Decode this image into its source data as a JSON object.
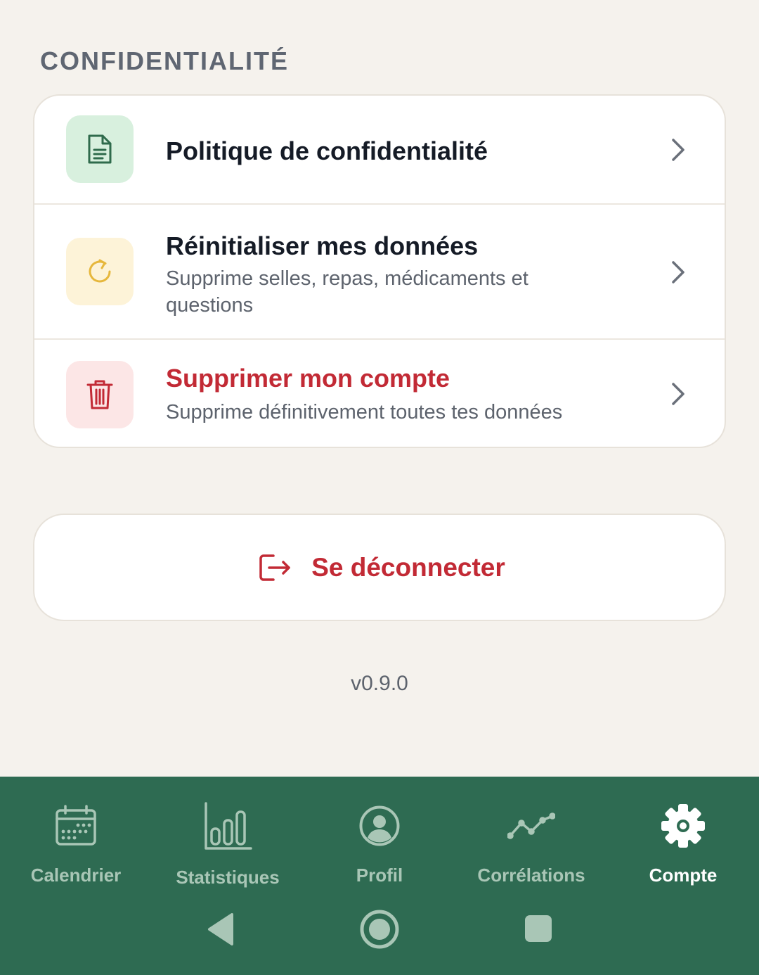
{
  "section": {
    "title": "CONFIDENTIALITÉ"
  },
  "items": [
    {
      "icon": "document-icon",
      "title": "Politique de confidentialité",
      "subtitle": ""
    },
    {
      "icon": "refresh-icon",
      "title": "Réinitialiser mes données",
      "subtitle": "Supprime selles, repas, médicaments et questions"
    },
    {
      "icon": "trash-icon",
      "title": "Supprimer mon compte",
      "subtitle": "Supprime définitivement toutes tes données"
    }
  ],
  "logout": {
    "icon": "logout-icon",
    "label": "Se déconnecter"
  },
  "version": "v0.9.0",
  "nav": [
    {
      "icon": "calendar-icon",
      "label": "Calendrier",
      "active": false
    },
    {
      "icon": "bar-chart-icon",
      "label": "Statistiques",
      "active": false
    },
    {
      "icon": "user-circle-icon",
      "label": "Profil",
      "active": false
    },
    {
      "icon": "trend-line-icon",
      "label": "Corrélations",
      "active": false
    },
    {
      "icon": "gear-icon",
      "label": "Compte",
      "active": true
    }
  ],
  "colors": {
    "background": "#f5f2ed",
    "nav_background": "#2e6b52",
    "danger": "#c22a35",
    "nav_inactive": "#a9c6b6",
    "nav_active": "#ffffff"
  }
}
